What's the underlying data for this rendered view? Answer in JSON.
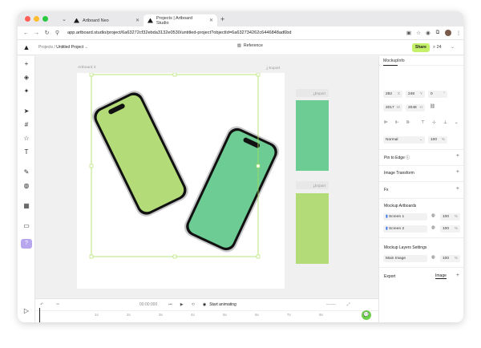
{
  "colors": {
    "accent": "#c5f06a",
    "mockup_light": "#b3dc78",
    "mockup_green": "#6ccc93",
    "traffic_red": "#ff5f57",
    "traffic_yellow": "#febc2e",
    "traffic_green": "#28c840"
  },
  "browser": {
    "tabs": [
      {
        "label": "Artboard Neo",
        "icon": "artboard-logo-icon"
      },
      {
        "label": "Projects | Artboard Studio",
        "icon": "artboard-logo-icon"
      }
    ],
    "url": "app.artboard.studio/project/6a63272cf32ebda3132e0530/untitled-project?objectId=6a632734262c6446848ad6bd"
  },
  "header": {
    "crumb_parent": "Projects /",
    "crumb_current": "Untitled Project",
    "reference_label": "Reference",
    "share_label": "Share",
    "zoom_label": "24"
  },
  "canvas": {
    "artboard_label": "Artboard 3",
    "export_label": "Export",
    "side_export_1": "Export",
    "side_export_2": "Export"
  },
  "timeline": {
    "time": "00:00:000",
    "start_label": "Start animating",
    "ticks": [
      "1s",
      "2s",
      "3s",
      "4s",
      "5s",
      "6s",
      "7s",
      "8s"
    ]
  },
  "panel": {
    "tabs": [
      "Mockup",
      "Info"
    ],
    "x": "282",
    "y": "248",
    "rotation": "0",
    "w": "2017",
    "h": "2048",
    "blend_mode": "Normal",
    "opacity": "100",
    "pin_to_edge": "Pin to Edge",
    "image_transform": "Image Transform",
    "fx": "Fx",
    "mockup_artboards": "Mockup Artboards",
    "screens": [
      {
        "label": "Screen 1",
        "value": "100"
      },
      {
        "label": "Screen 2",
        "value": "100"
      }
    ],
    "layers_settings": "Mockup Layers Settings",
    "main_image": "Main Image",
    "main_image_value": "100",
    "export_label": "Export",
    "image_label": "Image",
    "units": {
      "x": "X",
      "y": "Y",
      "w": "W",
      "h": "H",
      "pct": "%"
    }
  }
}
